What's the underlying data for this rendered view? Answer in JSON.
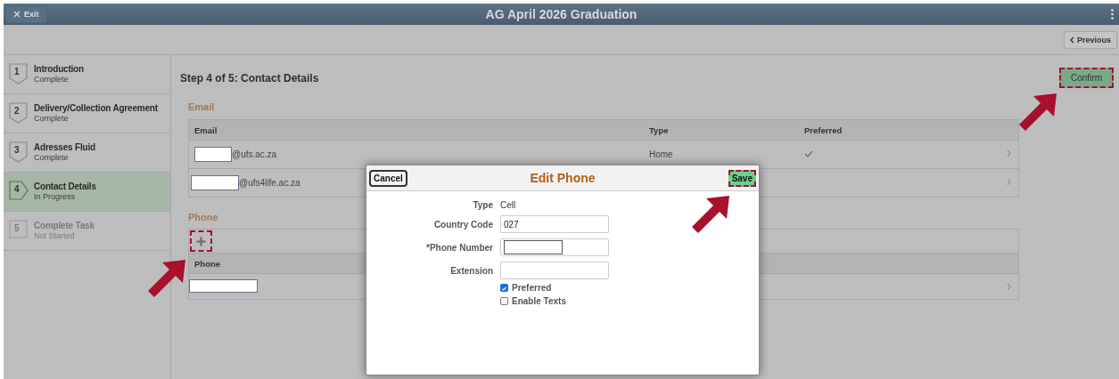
{
  "header": {
    "exit": "Exit",
    "title": "AG April 2026 Graduation"
  },
  "toolbar": {
    "previous": "Previous"
  },
  "steps": [
    {
      "number": "1",
      "title": "Introduction",
      "status": "Complete",
      "selected": false,
      "disabled": false
    },
    {
      "number": "2",
      "title": "Delivery/Collection Agreement",
      "status": "Complete",
      "selected": false,
      "disabled": false
    },
    {
      "number": "3",
      "title": "Adresses Fluid",
      "status": "Complete",
      "selected": false,
      "disabled": false
    },
    {
      "number": "4",
      "title": "Contact Details",
      "status": "In Progress",
      "selected": true,
      "disabled": false
    },
    {
      "number": "5",
      "title": "Complete Task",
      "status": "Not Started",
      "selected": false,
      "disabled": true
    }
  ],
  "page": {
    "heading": "Step 4 of 5: Contact Details",
    "confirm": "Confirm"
  },
  "email": {
    "title": "Email",
    "columns": [
      "Email",
      "Type",
      "Preferred"
    ],
    "rows": [
      {
        "domain": "@ufs.ac.za",
        "type": "Home",
        "preferred": true
      },
      {
        "domain": "@ufs4life.ac.za",
        "preferred": false
      }
    ]
  },
  "phone": {
    "title": "Phone",
    "columns": [
      "Phone"
    ],
    "rows": [
      {
        "kind": "blank-input"
      }
    ]
  },
  "dialog": {
    "title": "Edit Phone",
    "cancel": "Cancel",
    "save": "Save",
    "fields": [
      {
        "kind": "text",
        "label": "Type",
        "value": "Cell"
      },
      {
        "kind": "input",
        "label": "Country Code",
        "value": "027"
      },
      {
        "kind": "masked-input",
        "label": "*Phone Number"
      },
      {
        "kind": "input",
        "label": "Extension"
      },
      {
        "kind": "checkbox",
        "label": "Preferred",
        "checked": true
      },
      {
        "kind": "checkbox",
        "label": "Enable Texts",
        "checked": false
      }
    ]
  }
}
